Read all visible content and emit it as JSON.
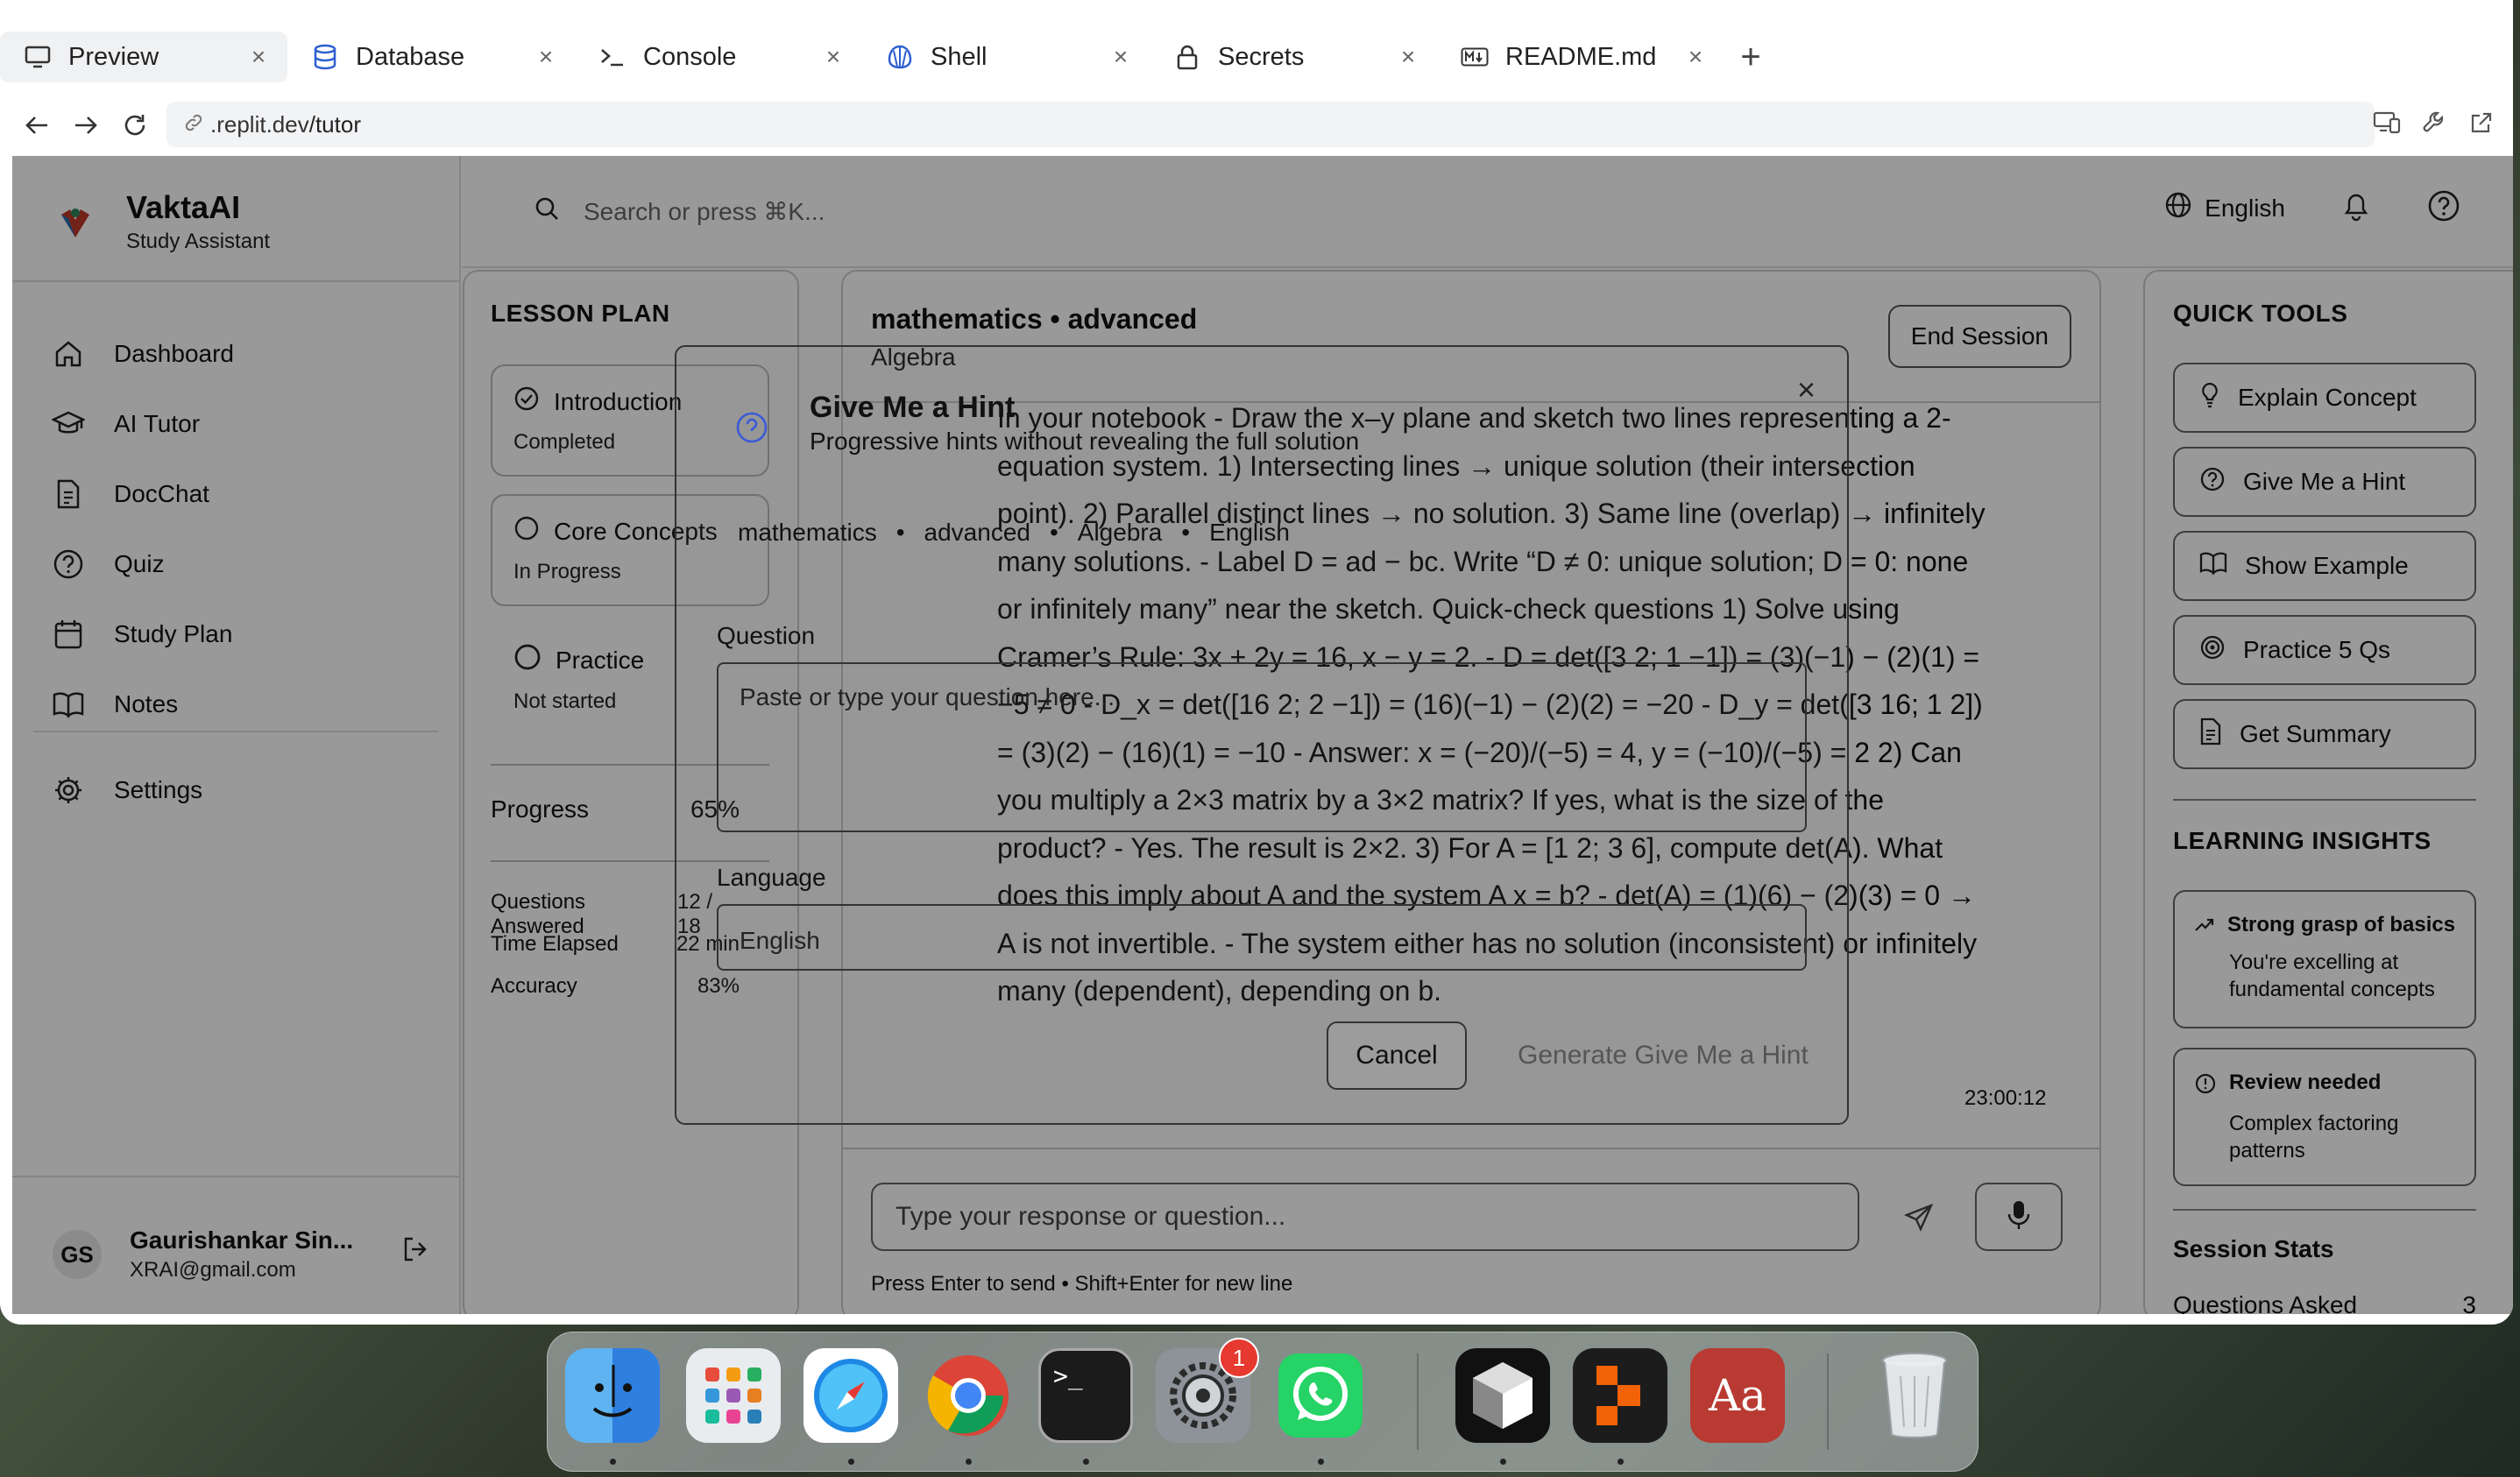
{
  "browser": {
    "tabs": [
      {
        "label": "Preview",
        "icon": "preview-icon",
        "active": true
      },
      {
        "label": "Database",
        "icon": "database-icon"
      },
      {
        "label": "Console",
        "icon": "console-icon"
      },
      {
        "label": "Shell",
        "icon": "shell-icon"
      },
      {
        "label": "Secrets",
        "icon": "lock-icon"
      },
      {
        "label": "README.md",
        "icon": "markdown-icon"
      }
    ],
    "close_glyph": "×",
    "new_tab_glyph": "+",
    "url_host": ".replit.dev",
    "url_path": "/tutor"
  },
  "app": {
    "brand": {
      "name": "VaktaAI",
      "subtitle": "Study Assistant"
    },
    "nav": [
      {
        "label": "Dashboard",
        "icon": "home-icon"
      },
      {
        "label": "AI Tutor",
        "icon": "graduation-cap-icon"
      },
      {
        "label": "DocChat",
        "icon": "document-icon"
      },
      {
        "label": "Quiz",
        "icon": "help-circle-icon"
      },
      {
        "label": "Study Plan",
        "icon": "calendar-icon"
      },
      {
        "label": "Notes",
        "icon": "book-icon"
      }
    ],
    "settings_label": "Settings",
    "user": {
      "initials": "GS",
      "name": "Gaurishankar Sin...",
      "email": "XRAI@gmail.com"
    },
    "search_placeholder": "Search or press ⌘K...",
    "language": "English"
  },
  "lesson": {
    "title": "LESSON PLAN",
    "steps": [
      {
        "name": "Introduction",
        "status": "Completed"
      },
      {
        "name": "Core Concepts",
        "status": "In Progress"
      },
      {
        "name": "Practice",
        "status": "Not started"
      }
    ],
    "progress_label": "Progress",
    "progress_value": "65%",
    "stats": [
      {
        "label": "Questions Answered",
        "value": "12 / 18"
      },
      {
        "label": "Time Elapsed",
        "value": "22 min"
      },
      {
        "label": "Accuracy",
        "value": "83%"
      }
    ]
  },
  "chat": {
    "title": "mathematics • advanced",
    "subtitle": "Algebra",
    "end_session": "End Session",
    "message": "In your notebook - Draw the x–y plane and sketch two lines representing a 2-equation system. 1) Intersecting lines → unique solution (their intersection point). 2) Parallel distinct lines → no solution. 3) Same line (overlap) → infinitely many solutions. - Label D = ad − bc. Write “D ≠ 0: unique solution; D = 0: none or infinitely many” near the sketch. Quick-check questions 1) Solve using Cramer’s Rule: 3x + 2y = 16, x − y = 2. - D = det([3 2; 1 −1]) = (3)(−1) − (2)(1) = −5 ≠ 0 - D_x = det([16 2; 2 −1]) = (16)(−1) − (2)(2) = −20 - D_y = det([3 16; 1 2]) = (3)(2) − (16)(1) = −10 - Answer: x = (−20)/(−5) = 4, y = (−10)/(−5) = 2 2) Can you multiply a 2×3 matrix by a 3×2 matrix? If yes, what is the size of the product? - Yes. The result is 2×2. 3) For A = [1 2; 3 6], compute det(A). What does this imply about A and the system A x = b? - det(A) = (1)(6) − (2)(3) = 0 → A is not invertible. - The system either has no solution (inconsistent) or infinitely many (dependent), depending on b.",
    "timestamp": "23:00:12",
    "input_placeholder": "Type your response or question...",
    "hint_text": "Press Enter to send • Shift+Enter for new line"
  },
  "tools": {
    "title": "QUICK TOOLS",
    "buttons": [
      {
        "label": "Explain Concept",
        "icon": "lightbulb-icon"
      },
      {
        "label": "Give Me a Hint",
        "icon": "help-circle-icon"
      },
      {
        "label": "Show Example",
        "icon": "book-open-icon"
      },
      {
        "label": "Practice 5 Qs",
        "icon": "target-icon"
      },
      {
        "label": "Get Summary",
        "icon": "document-icon"
      }
    ],
    "insights_title": "LEARNING INSIGHTS",
    "insights": [
      {
        "title": "Strong grasp of basics",
        "body": "You're excelling at fundamental concepts",
        "icon": "trending-up-icon"
      },
      {
        "title": "Review needed",
        "body": "Complex factoring patterns",
        "icon": "alert-circle-icon"
      }
    ],
    "session_stats_title": "Session Stats",
    "session_stats": [
      {
        "label": "Questions Asked",
        "value": "3"
      }
    ]
  },
  "modal": {
    "title": "Give Me a Hint",
    "subtitle": "Progressive hints without revealing the full solution",
    "meta": [
      "mathematics",
      "•",
      "advanced",
      "•",
      "Algebra",
      "•",
      "English"
    ],
    "close_glyph": "×",
    "question_label": "Question",
    "question_placeholder": "Paste or type your question here...",
    "language_label": "Language",
    "language_value": "English",
    "cancel": "Cancel",
    "generate": "Generate Give Me a Hint"
  },
  "dock": {
    "items": [
      "finder-icon",
      "launchpad-icon",
      "safari-icon",
      "chrome-icon",
      "terminal-icon",
      "system-settings-icon",
      "whatsapp-icon",
      "unity-icon",
      "replit-icon",
      "dictionary-icon",
      "trash-icon"
    ],
    "settings_badge": "1",
    "dictionary_glyph": "Aa",
    "terminal_glyph": ">_"
  },
  "colors": {
    "overlay": "#000000",
    "badge": "#e6392f",
    "chrome_blue": "#4285f4"
  }
}
